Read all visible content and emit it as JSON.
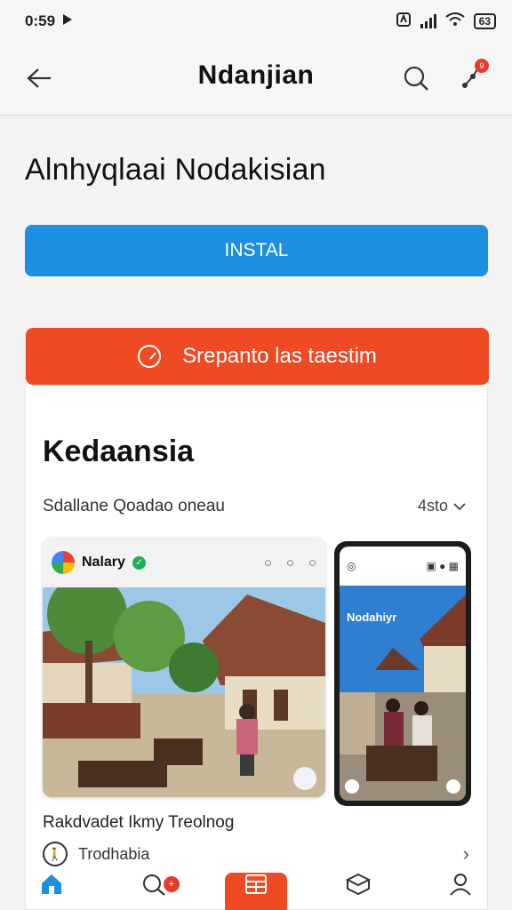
{
  "status": {
    "time": "0:59",
    "battery": "63"
  },
  "app_bar": {
    "title": "Ndanjian",
    "notification_count": "9"
  },
  "app": {
    "name": "Alnhyqlaai Nodakisian",
    "install_label": "INSTAL"
  },
  "report": {
    "label": "Srepanto las taestim"
  },
  "section": {
    "title": "Kedaansia",
    "subtitle": "Sdallane Qoadao oneau",
    "count": "4sto"
  },
  "screenshot1": {
    "name": "Nalary"
  },
  "screenshot2": {
    "title": "Nodahiyr"
  },
  "listing": {
    "title": "Rakdvadet Ikmy Treolnog",
    "row_label": "Trodhabia"
  },
  "tabs": [
    {
      "label": "Home",
      "icon": "home-icon"
    },
    {
      "label": "Explore",
      "icon": "search-icon"
    },
    {
      "label": "Apps",
      "icon": "apps-icon"
    },
    {
      "label": "Discover",
      "icon": "package-icon"
    },
    {
      "label": "Profile",
      "icon": "person-icon"
    }
  ],
  "colors": {
    "accent_blue": "#1d8fe1",
    "accent_orange": "#ee4a24"
  }
}
